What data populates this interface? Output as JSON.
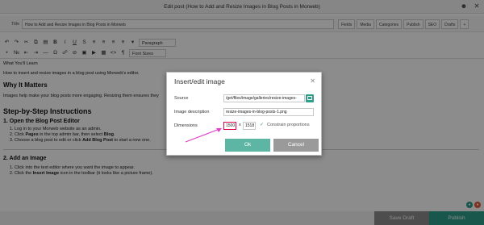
{
  "window": {
    "title": "Edit post (How to Add and Resize Images in Blog Posts in Morweb)"
  },
  "title_row": {
    "label": "Title",
    "value": "How to Add and Resize Images in Blog Posts in Morweb",
    "tabs": [
      "Fields",
      "Media",
      "Categories",
      "Publish",
      "SEO",
      "Drafts",
      "+"
    ]
  },
  "toolbar": {
    "paragraph_select": "Paragraph",
    "font_sizes_select": "Font Sizes"
  },
  "content": {
    "learn_heading": "What You'll Learn",
    "learn_text": "How to insert and resize images in a blog post using Morweb's editor.",
    "why_heading": "Why It Matters",
    "why_text": "Images help make your blog posts more engaging. Resizing them ensures they",
    "steps_heading": "Step-by-Step Instructions",
    "step1_heading": "1. Open the Blog Post Editor",
    "step1_items": [
      "Log in to your Morweb website as an admin.",
      [
        "Click ",
        "Pages",
        " in the top admin bar, then select ",
        "Blog",
        "."
      ],
      [
        "Choose a blog post to edit or click ",
        "Add Blog Post",
        " to start a new one."
      ]
    ],
    "step2_heading": "2. Add an Image",
    "step2_items": [
      "Click into the text editor where you want the image to appear.",
      [
        "Click the ",
        "Insert Image",
        " icon in the toolbar (it looks like a picture frame)."
      ]
    ]
  },
  "footer": {
    "save_draft": "Save Draft",
    "publish": "Publish"
  },
  "modal": {
    "title": "Insert/edit image",
    "source_label": "Source",
    "source_value": "/get/files/image/galleries/resize-images-",
    "description_label": "Image description",
    "description_value": "resize-images-in-blog-posts-1.png",
    "dimensions_label": "Dimensions",
    "width": "1500",
    "height": "1518",
    "times": "x",
    "constrain_label": "Constrain proportions",
    "ok": "Ok",
    "cancel": "Cancel"
  },
  "colors": {
    "accent": "#2f9e8a",
    "arrow": "#e040c8"
  }
}
